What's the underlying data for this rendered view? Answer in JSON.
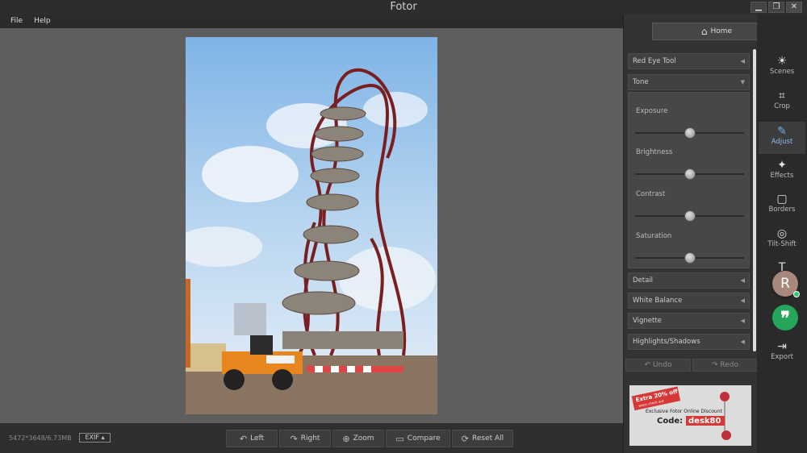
{
  "window": {
    "title": "Fotor",
    "minimize": "▁",
    "restore": "❐",
    "close": "✕"
  },
  "menu": [
    "File",
    "Help"
  ],
  "statusbar": {
    "dimensions": "5472*3648/6.73MB",
    "exif": "EXIF ▴"
  },
  "bottom_tools": [
    {
      "label": "Left",
      "icon": "rotate-left-icon"
    },
    {
      "label": "Right",
      "icon": "rotate-right-icon"
    },
    {
      "label": "Zoom",
      "icon": "zoom-icon"
    },
    {
      "label": "Compare",
      "icon": "compare-icon"
    },
    {
      "label": "Reset  All",
      "icon": "reset-icon"
    }
  ],
  "panel": {
    "home": "Home",
    "sections": {
      "red_eye": "Red Eye Tool",
      "tone": "Tone",
      "detail": "Detail",
      "white_balance": "White Balance",
      "vignette": "Vignette",
      "highlights": "Highlights/Shadows"
    },
    "sliders": [
      {
        "label": "Exposure",
        "value": 0.5
      },
      {
        "label": "Brightness",
        "value": 0.5
      },
      {
        "label": "Contrast",
        "value": 0.5
      },
      {
        "label": "Saturation",
        "value": 0.5
      }
    ],
    "undo": "Undo",
    "redo": "Redo",
    "ad": {
      "badge": "Extra 20% off",
      "badge_sub": "when check out",
      "line": "Exclusive Fotor Online Discount",
      "code_label": "Code:",
      "code": "desk80"
    }
  },
  "sidebar": [
    {
      "label": "Scenes",
      "icon": "sun-icon"
    },
    {
      "label": "Crop",
      "icon": "crop-icon"
    },
    {
      "label": "Adjust",
      "icon": "pencil-icon",
      "active": true
    },
    {
      "label": "Effects",
      "icon": "sparkle-icon"
    },
    {
      "label": "Borders",
      "icon": "frame-icon"
    },
    {
      "label": "Tilt-Shift",
      "icon": "target-icon"
    },
    {
      "label": "Text",
      "icon": "text-icon"
    },
    {
      "label": "Export",
      "icon": "export-icon"
    }
  ],
  "overlay": {
    "avatar_letter": "R"
  }
}
